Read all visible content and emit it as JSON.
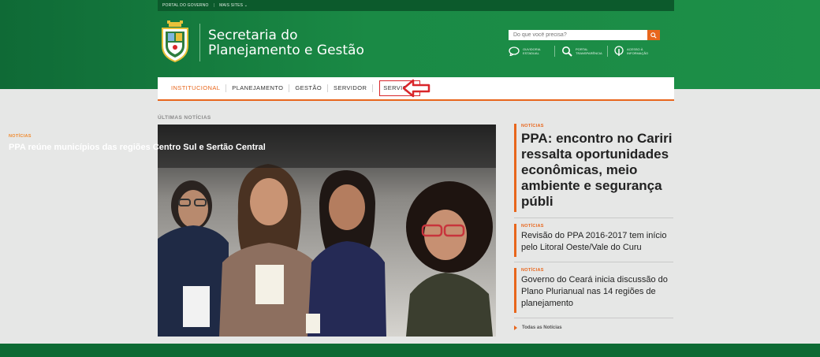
{
  "topbar": {
    "portal": "PORTAL DO GOVERNO",
    "separator": "|",
    "more_sites": "MAIS SITES"
  },
  "brand": {
    "line1": "Secretaria do",
    "line2": "Planejamento e Gestão"
  },
  "search": {
    "placeholder": "Do que você precisa?"
  },
  "quick_links": [
    {
      "label": "OUVIDORIA ESTADUAL",
      "icon": "chat-bubble-icon"
    },
    {
      "label": "PORTAL TRANSPARÊNCIA",
      "icon": "magnifier-icon"
    },
    {
      "label": "ACESSO À INFORMAÇÃO",
      "icon": "info-pin-icon"
    }
  ],
  "nav": {
    "items": [
      "INSTITUCIONAL",
      "PLANEJAMENTO",
      "GESTÃO",
      "SERVIDOR",
      "SERVIÇOS"
    ],
    "active_index": 0,
    "highlighted_index": 4
  },
  "section_label": "ÚLTIMAS NOTÍCIAS",
  "hero": {
    "tag": "NOTÍCIAS",
    "title": "PPA reúne municípios das regiões Centro Sul e Sertão Central"
  },
  "news": [
    {
      "tag": "NOTÍCIAS",
      "title": "PPA: encontro no Cariri ressalta oportunidades econômicas, meio ambiente e segurança públi"
    },
    {
      "tag": "NOTÍCIAS",
      "title": "Revisão do PPA 2016-2017 tem início pelo Litoral Oeste/Vale do Curu"
    },
    {
      "tag": "NOTÍCIAS",
      "title": "Governo do Ceará inicia discussão do Plano Plurianual nas 14 regiões de planejamento"
    }
  ],
  "all_news_label": "Todas as Notícias",
  "colors": {
    "brand_green": "#1a8a45",
    "dark_green": "#0c5a2c",
    "accent_orange": "#e8661c",
    "highlight_red": "#d9262a"
  }
}
